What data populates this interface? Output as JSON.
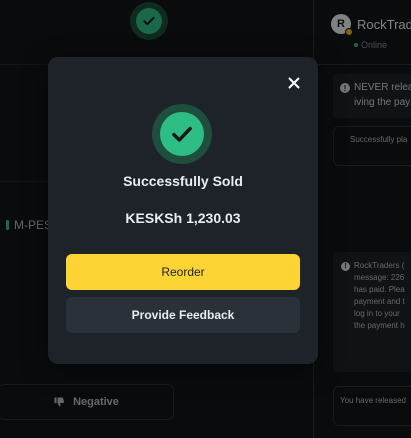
{
  "background": {
    "payment_method": "M-PES",
    "negative_label": "Negative"
  },
  "chat": {
    "merchant_name": "RockTraders",
    "avatar_letter": "R",
    "status": "Online",
    "warning_lines": [
      "NEVER releas",
      "iving the pay"
    ],
    "system_message": "Successfully pla",
    "info_lines": [
      "RockTraders (",
      "message: 226",
      "has paid. Plea",
      "payment and t",
      "log in to your",
      "the payment h"
    ],
    "released_message": "You have released"
  },
  "modal": {
    "title": "Successfully Sold",
    "amount": "KESKSh 1,230.03",
    "reorder_label": "Reorder",
    "feedback_label": "Provide Feedback"
  },
  "colors": {
    "accent_yellow": "#fcd535",
    "success_green": "#2ebd85",
    "modal_bg": "#1e2329"
  },
  "icons": {
    "close": "close-icon",
    "success": "check-circle-icon",
    "negative": "thumbs-down-icon",
    "warning": "info-icon"
  }
}
